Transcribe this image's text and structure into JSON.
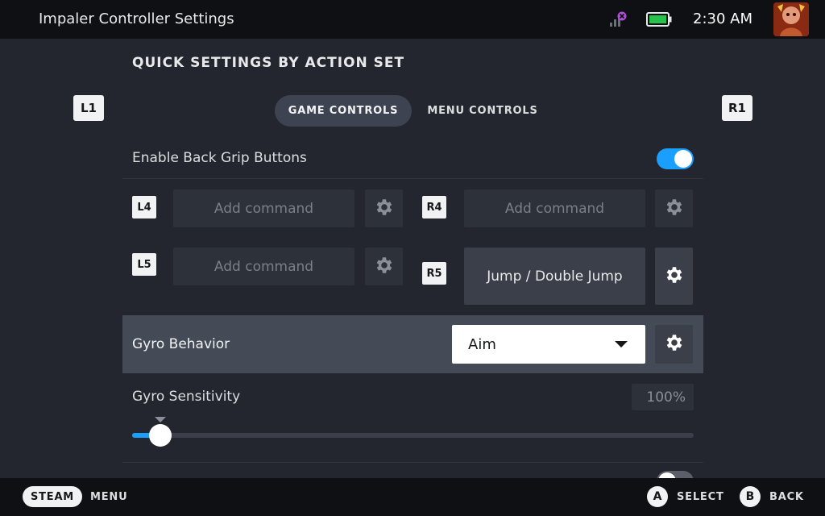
{
  "topbar": {
    "title": "Impaler Controller Settings",
    "time": "2:30 AM",
    "network_icon": "network-disconnected-icon",
    "battery_icon": "battery-full-icon",
    "battery_color": "#27c24c"
  },
  "page": {
    "section_title": "QUICK SETTINGS BY ACTION SET",
    "left_bumper": "L1",
    "right_bumper": "R1",
    "tabs": [
      {
        "label": "GAME CONTROLS",
        "active": true
      },
      {
        "label": "MENU CONTROLS",
        "active": false
      }
    ]
  },
  "back_grip": {
    "label": "Enable Back Grip Buttons",
    "enabled": true
  },
  "grip_buttons": [
    {
      "key": "L4",
      "command": "Add command"
    },
    {
      "key": "R4",
      "command": "Add command"
    },
    {
      "key": "L5",
      "command": "Add command"
    },
    {
      "key": "R5",
      "command": "Jump / Double Jump"
    }
  ],
  "gyro": {
    "behavior_label": "Gyro Behavior",
    "behavior_value": "Aim",
    "sensitivity_label": "Gyro Sensitivity",
    "sensitivity_value": "100%",
    "sensitivity_fraction": 0.05
  },
  "next_row_toggle": {
    "enabled": false
  },
  "bottombar": {
    "steam_label": "STEAM",
    "menu_label": "MENU",
    "a_button": "A",
    "select_label": "SELECT",
    "b_button": "B",
    "back_label": "BACK"
  },
  "colors": {
    "accent": "#1a9fff",
    "background": "#23262e",
    "bar": "#0e1013"
  }
}
